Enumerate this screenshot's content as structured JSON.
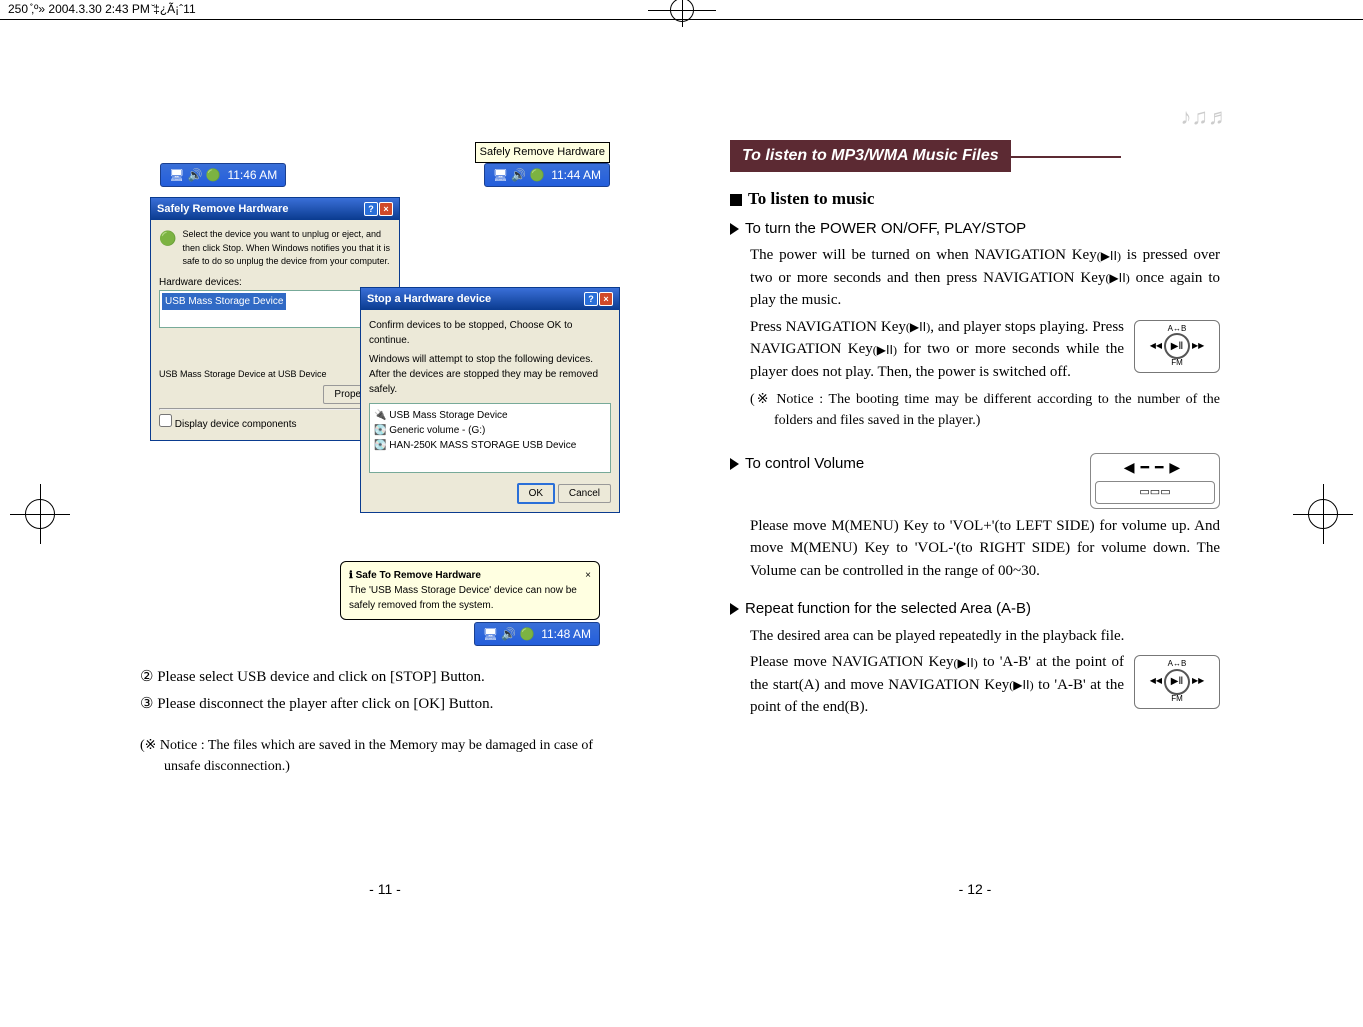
{
  "crop": {
    "filename": "250 ̊‚º» 2004.3.30 2:43 PM ̆‡¿Ã¡ˆ11"
  },
  "left": {
    "taskbar1_time": "11:46 AM",
    "balloon_safely": "Safely Remove Hardware",
    "taskbar2_time": "11:44 AM",
    "dlg1_title": "Safely Remove Hardware",
    "dlg1_instr": "Select the device you want to unplug or eject, and then click Stop. When Windows notifies you that it is safe to do so unplug the device from your computer.",
    "dlg1_hw_label": "Hardware devices:",
    "dlg1_hw_item": "USB Mass Storage Device",
    "dlg1_status": "USB Mass Storage Device at USB Device",
    "dlg1_properties": "Properties",
    "dlg1_checkbox": "Display device components",
    "dlg2_title": "Stop a Hardware device",
    "dlg2_line1": "Confirm devices to be stopped, Choose OK to continue.",
    "dlg2_line2": "Windows will attempt to stop the following devices. After the devices are stopped they may be removed safely.",
    "dlg2_item1": "USB Mass Storage Device",
    "dlg2_item2": "Generic volume - (G:)",
    "dlg2_item3": "HAN-250K MASS STORAGE USB Device",
    "dlg2_ok": "OK",
    "dlg2_cancel": "Cancel",
    "balloon2_title": "Safe To Remove Hardware",
    "balloon2_body": "The 'USB Mass Storage Device' device can now be safely removed from the system.",
    "balloon2_time": "11:48 AM",
    "step2": "②  Please select USB device and click on [STOP] Button.",
    "step3": "③  Please disconnect the player after click on [OK] Button.",
    "notice": "(※ Notice : The files which are saved in the Memory may be damaged in case of unsafe disconnection.)",
    "pagefoot": "-  11  -"
  },
  "right": {
    "header": "To listen to MP3/WMA Music Files",
    "h_listen": "To listen to music",
    "sub_power": "To turn the POWER ON/OFF, PLAY/STOP",
    "para1a": "The power will be turned on when NAVIGATION Key",
    "para1b": " is pressed over two or more seconds and then press NAVIGATION Key",
    "para1c": " once again to play the music.",
    "para2a": "Press NAVIGATION Key",
    "para2b": ", and player stops playing. Press NAVIGATION Key",
    "para2c": " for two or more seconds while the player does not play. Then, the power is switched off.",
    "notice_boot": "(※ Notice : The booting time may be different according to the number of the folders and files saved in the player.)",
    "sub_vol": "To control Volume",
    "para_vol": "Please move M(MENU) Key to 'VOL+'(to LEFT SIDE) for volume up. And move M(MENU) Key to 'VOL-'(to RIGHT SIDE) for volume down. The Volume can be controlled in the range of 00~30.",
    "sub_repeat": "Repeat function for the selected Area (A-B)",
    "para_repeat_intro": "The desired area can be played repeatedly in the playback file.",
    "para_repeat_a": "Please move NAVIGATION Key",
    "para_repeat_b": " to 'A-B' at the point of the start(A)  and move NAVIGATION Key",
    "para_repeat_c": " to 'A-B' at the point of the end(B).",
    "nav_top": "A↔B",
    "nav_bottom": "FM",
    "pagefoot": "-  12  -",
    "play_icon": "(▶ⅠⅠ)"
  }
}
